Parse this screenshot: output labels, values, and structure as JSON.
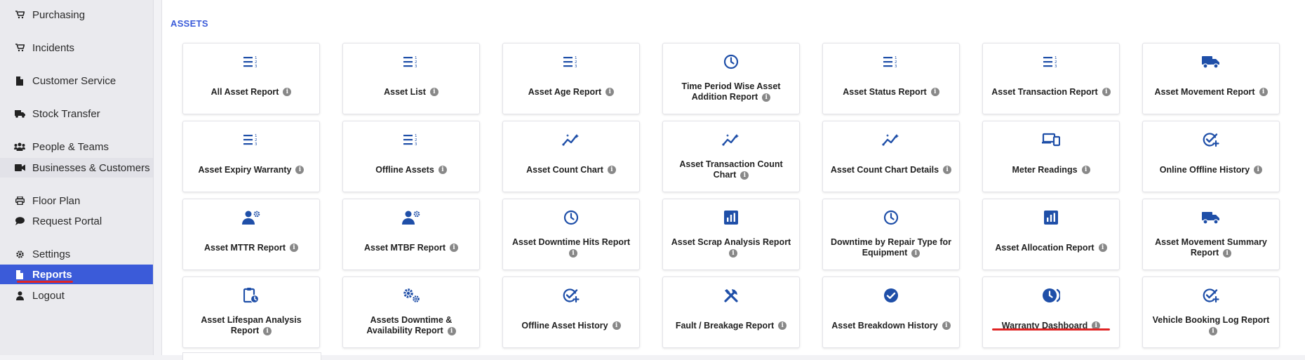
{
  "sidebar": {
    "items": [
      {
        "label": "Purchasing",
        "icon": "cart-icon"
      },
      {
        "label": "Incidents",
        "icon": "cart-icon"
      },
      {
        "label": "Customer Service",
        "icon": "document-icon"
      },
      {
        "label": "Stock Transfer",
        "icon": "truck-icon"
      },
      {
        "label": "People & Teams",
        "icon": "users-icon"
      },
      {
        "label": "Businesses & Customers",
        "icon": "video-icon"
      },
      {
        "label": "Floor Plan",
        "icon": "printer-icon"
      },
      {
        "label": "Request Portal",
        "icon": "chat-icon"
      },
      {
        "label": "Settings",
        "icon": "gear-icon"
      },
      {
        "label": "Reports",
        "icon": "document-icon",
        "active": true
      },
      {
        "label": "Logout",
        "icon": "user-icon"
      }
    ]
  },
  "section": {
    "title": "ASSETS"
  },
  "info_glyph": "i",
  "accent_color": "#3b5bd9",
  "icon_color": "#1f4fa8",
  "cards": [
    {
      "label": "All Asset Report",
      "icon": "list-numbered-icon"
    },
    {
      "label": "Asset List",
      "icon": "list-numbered-icon"
    },
    {
      "label": "Asset Age Report",
      "icon": "list-numbered-icon"
    },
    {
      "label": "Time Period Wise Asset Addition Report",
      "icon": "clock-icon"
    },
    {
      "label": "Asset Status Report",
      "icon": "list-numbered-icon"
    },
    {
      "label": "Asset Transaction Report",
      "icon": "list-numbered-icon"
    },
    {
      "label": "Asset Movement Report",
      "icon": "truck-icon"
    },
    {
      "label": "Asset Expiry Warranty",
      "icon": "list-numbered-icon"
    },
    {
      "label": "Offline Assets",
      "icon": "list-numbered-icon"
    },
    {
      "label": "Asset Count Chart",
      "icon": "chart-line-icon"
    },
    {
      "label": "Asset Transaction Count Chart",
      "icon": "chart-line-icon"
    },
    {
      "label": "Asset Count Chart Details",
      "icon": "chart-line-icon"
    },
    {
      "label": "Meter Readings",
      "icon": "devices-icon"
    },
    {
      "label": "Online Offline History",
      "icon": "check-plus-icon"
    },
    {
      "label": "Asset MTTR Report",
      "icon": "user-gear-icon"
    },
    {
      "label": "Asset MTBF Report",
      "icon": "user-gear-icon"
    },
    {
      "label": "Asset Downtime Hits Report",
      "icon": "clock-icon"
    },
    {
      "label": "Asset Scrap Analysis Report",
      "icon": "bar-chart-icon"
    },
    {
      "label": "Downtime by Repair Type for Equipment",
      "icon": "clock-icon"
    },
    {
      "label": "Asset Allocation Report",
      "icon": "bar-chart-icon"
    },
    {
      "label": "Asset Movement Summary Report",
      "icon": "truck-icon"
    },
    {
      "label": "Asset Lifespan Analysis Report",
      "icon": "clipboard-clock-icon"
    },
    {
      "label": "Assets Downtime & Availability Report",
      "icon": "gears-icon"
    },
    {
      "label": "Offline Asset History",
      "icon": "check-plus-icon"
    },
    {
      "label": "Fault / Breakage Report",
      "icon": "tools-icon"
    },
    {
      "label": "Asset Breakdown History",
      "icon": "check-circle-icon"
    },
    {
      "label": "Warranty Dashboard",
      "icon": "clock-shield-icon"
    },
    {
      "label": "Vehicle Booking Log Report",
      "icon": "check-plus-icon"
    }
  ]
}
